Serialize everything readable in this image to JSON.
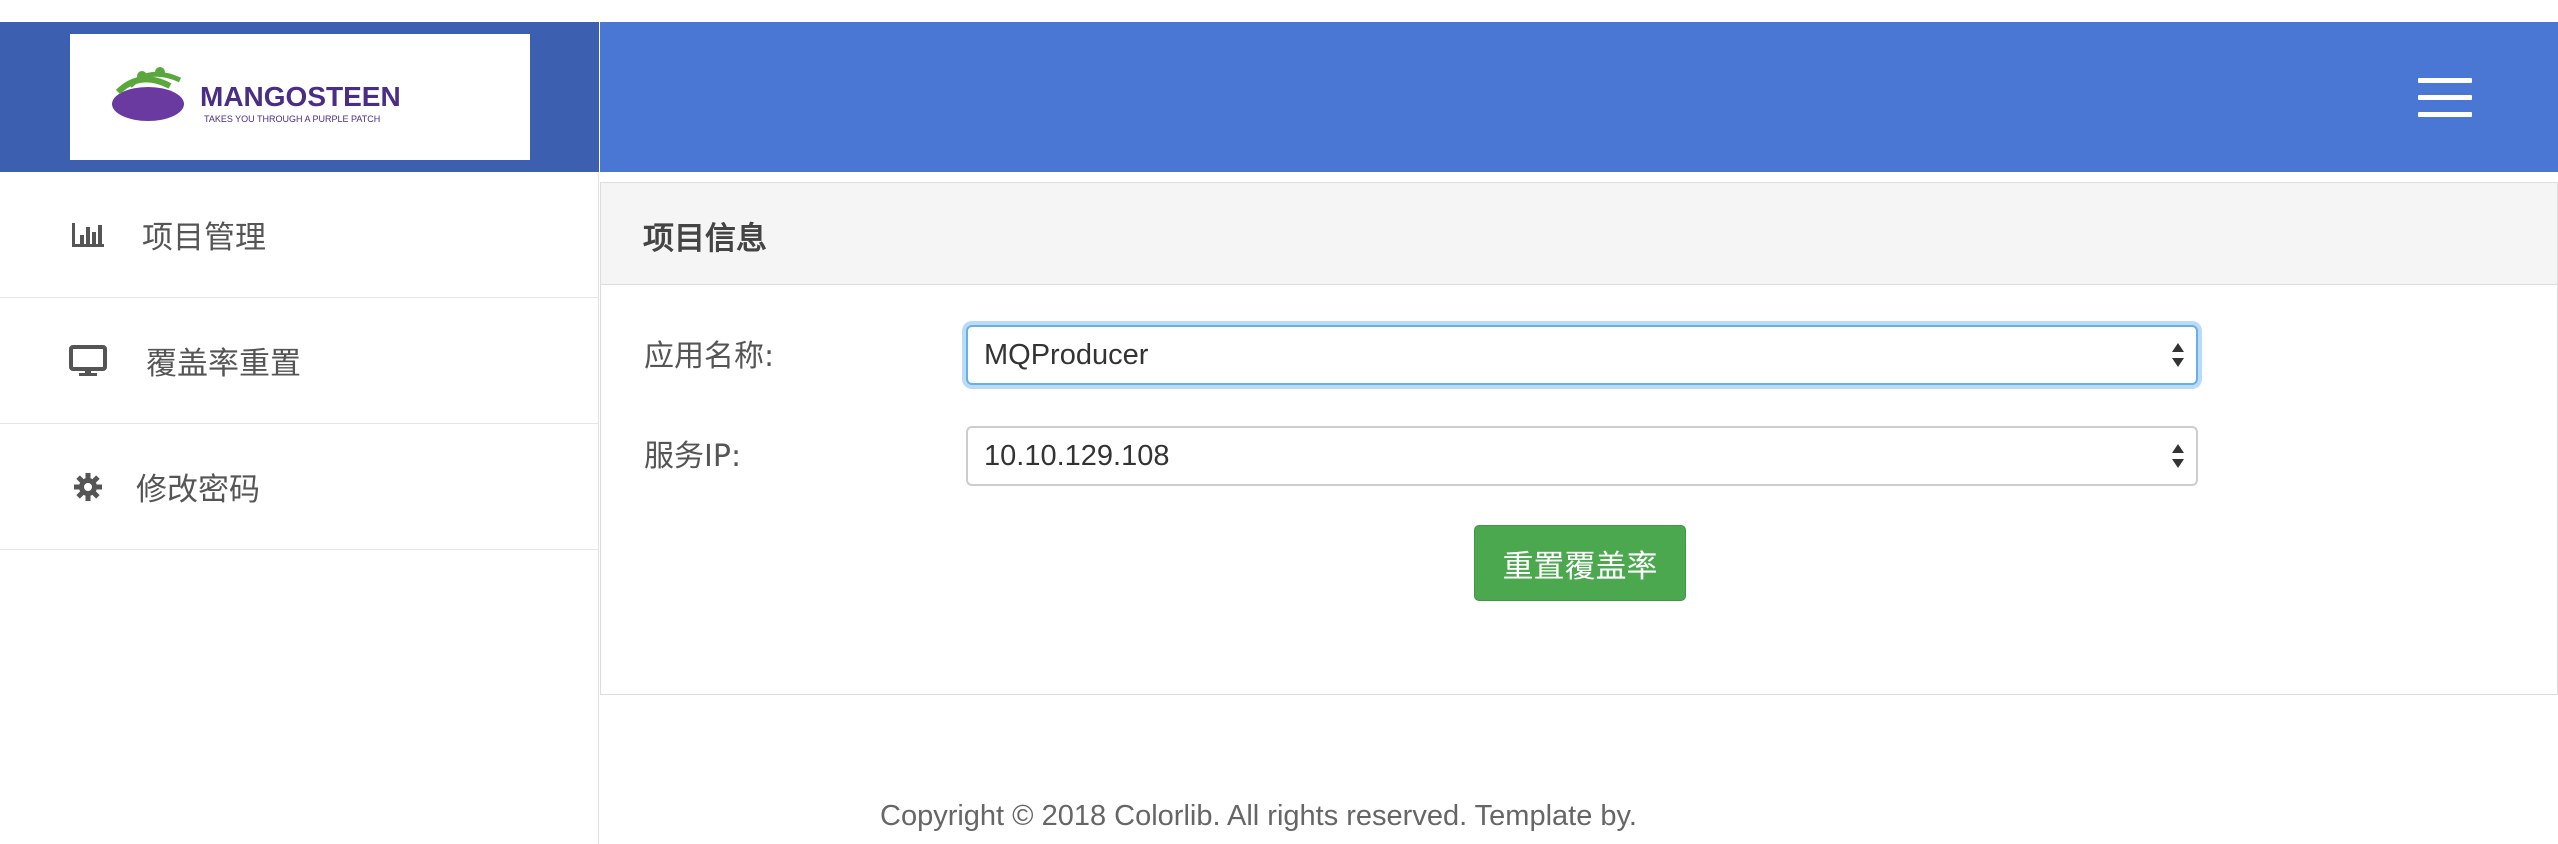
{
  "brand": {
    "logo_text": "MANGOSTEEN",
    "logo_tagline": "TAKES YOU THROUGH A PURPLE PATCH"
  },
  "sidebar": {
    "items": [
      {
        "label": "项目管理",
        "icon": "bar-chart-icon"
      },
      {
        "label": "覆盖率重置",
        "icon": "monitor-icon"
      },
      {
        "label": "修改密码",
        "icon": "gear-icon"
      }
    ]
  },
  "header": {
    "menu_icon": "hamburger-menu-icon",
    "color": "#4a76d4"
  },
  "panel": {
    "title": "项目信息",
    "fields": {
      "app_name_label": "应用名称:",
      "app_name_value": "MQProducer",
      "service_ip_label": "服务IP:",
      "service_ip_value": "10.10.129.108"
    },
    "reset_button": "重置覆盖率"
  },
  "footer": {
    "text": "Copyright © 2018 Colorlib. All rights reserved. Template by."
  },
  "colors": {
    "sidebar_logo_bg": "#3d5fb0",
    "header_bg": "#4a76d4",
    "button_green": "#4ca84f",
    "focus_blue": "#66afe9"
  }
}
